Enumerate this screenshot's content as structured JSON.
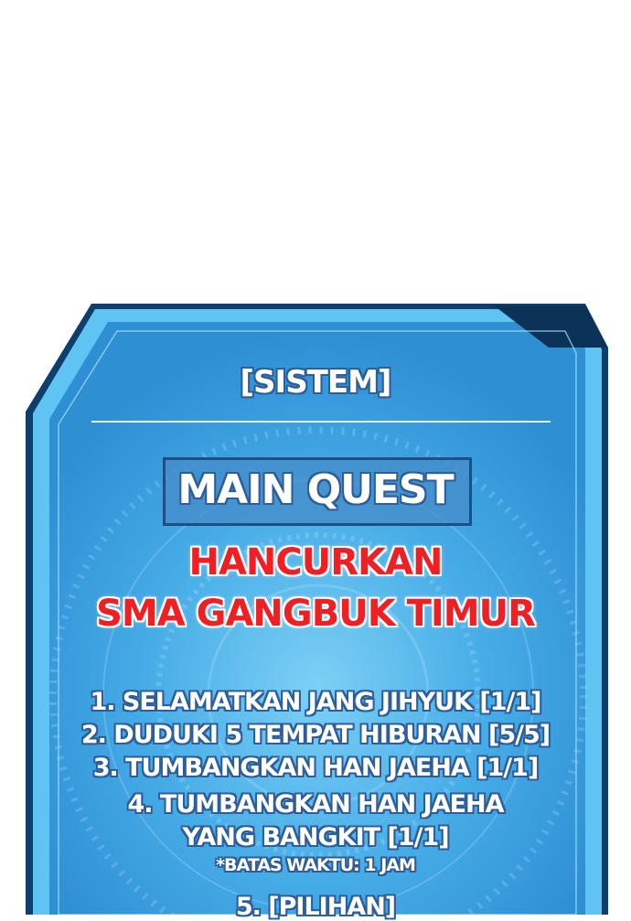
{
  "colors": {
    "panel_fill": "#3fa8e8",
    "panel_border": "#1a6fa8",
    "panel_edge_dark": "#0e3e6b",
    "title_red": "#ef1f24",
    "text_outline": "#2d5e9a"
  },
  "system": {
    "header": "[SISTEM]",
    "quest_type": "MAIN QUEST",
    "quest_title_line1": "HANCURKAN",
    "quest_title_line2": "SMA GANGBUK TIMUR",
    "objectives": [
      "1. SELAMATKAN JANG JIHYUK  [1/1]",
      "2. DUDUKI 5 TEMPAT HIBURAN  [5/5]",
      "3. TUMBANGKAN HAN JAEHA  [1/1]",
      "4. TUMBANGKAN HAN JAEHA",
      "YANG BANGKIT  [1/1]",
      "5. [PILIHAN]"
    ],
    "time_limit": "*BATAS WAKTU: 1 JAM"
  }
}
